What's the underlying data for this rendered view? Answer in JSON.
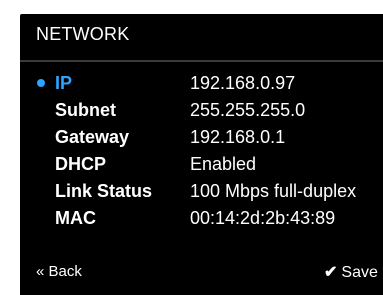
{
  "header": {
    "title": "NETWORK"
  },
  "fields": [
    {
      "label": "IP",
      "value": "192.168.0.97",
      "selected": true
    },
    {
      "label": "Subnet",
      "value": "255.255.255.0",
      "selected": false
    },
    {
      "label": "Gateway",
      "value": "192.168.0.1",
      "selected": false
    },
    {
      "label": "DHCP",
      "value": "Enabled",
      "selected": false
    },
    {
      "label": "Link Status",
      "value": "100 Mbps full-duplex",
      "selected": false
    },
    {
      "label": "MAC",
      "value": "00:14:2d:2b:43:89",
      "selected": false
    }
  ],
  "footer": {
    "back_label": "« Back",
    "save_label": "Save"
  },
  "colors": {
    "background": "#000000",
    "text": "#ffffff",
    "accent": "#2ea3ff"
  },
  "icons": {
    "selected_marker": "bullet-icon",
    "save": "checkmark-icon"
  }
}
